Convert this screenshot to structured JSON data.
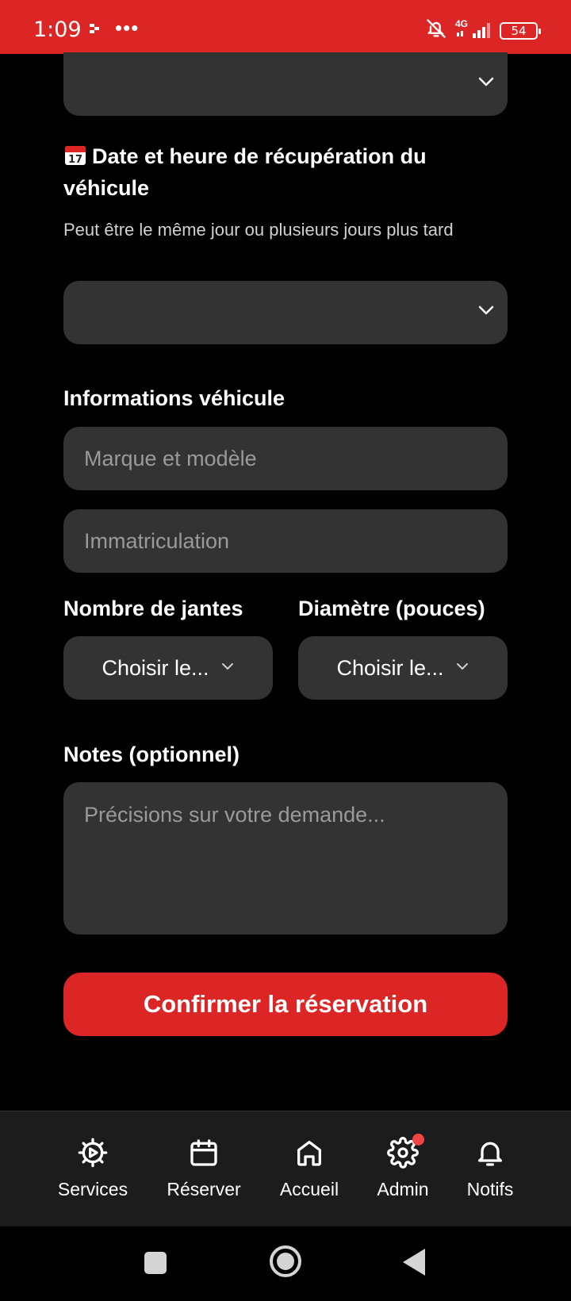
{
  "status_bar": {
    "time": "1:09",
    "more": "•••",
    "network": "4G",
    "battery": "54"
  },
  "form": {
    "pickup": {
      "title": "Date et heure de récupération du véhicule",
      "hint": "Peut être le même jour ou plusieurs jours plus tard"
    },
    "vehicle": {
      "title": "Informations véhicule",
      "brand_placeholder": "Marque et modèle",
      "plate_placeholder": "Immatriculation"
    },
    "rims": {
      "label": "Nombre de jantes",
      "value": "Choisir le..."
    },
    "diameter": {
      "label": "Diamètre (pouces)",
      "value": "Choisir le..."
    },
    "notes": {
      "title": "Notes (optionnel)",
      "placeholder": "Précisions sur votre demande..."
    },
    "confirm_label": "Confirmer la réservation"
  },
  "nav": {
    "items": [
      {
        "label": "Services",
        "icon": "services-gear-icon"
      },
      {
        "label": "Réserver",
        "icon": "calendar-icon"
      },
      {
        "label": "Accueil",
        "icon": "home-icon"
      },
      {
        "label": "Admin",
        "icon": "settings-icon"
      },
      {
        "label": "Notifs",
        "icon": "bell-icon"
      }
    ]
  },
  "colors": {
    "accent": "#dc2626",
    "field_bg": "#333333",
    "nav_bg": "#1c1c1c"
  }
}
